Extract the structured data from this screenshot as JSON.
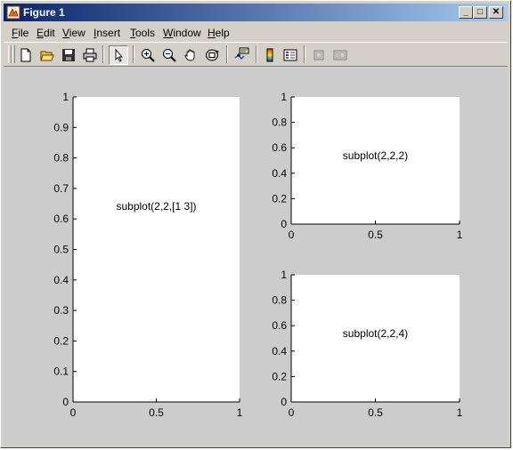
{
  "window": {
    "title": "Figure 1",
    "controls": {
      "minimize": "_",
      "maximize": "□",
      "close": "✕"
    }
  },
  "menubar": {
    "items": [
      {
        "key": "F",
        "rest": "ile"
      },
      {
        "key": "E",
        "rest": "dit"
      },
      {
        "key": "V",
        "rest": "iew"
      },
      {
        "key": "I",
        "rest": "nsert"
      },
      {
        "key": "T",
        "rest": "ools"
      },
      {
        "key": "W",
        "rest": "indow"
      },
      {
        "key": "H",
        "rest": "elp"
      }
    ]
  },
  "toolbar": {
    "icons": [
      "new-figure-icon",
      "open-file-icon",
      "save-icon",
      "print-icon",
      "edit-plot-arrow-icon",
      "zoom-in-icon",
      "zoom-out-icon",
      "pan-hand-icon",
      "rotate-3d-icon",
      "data-cursor-icon",
      "insert-colorbar-icon",
      "insert-legend-icon",
      "hide-plot-tools-icon",
      "show-plot-tools-icon"
    ]
  },
  "colors": {
    "titlebar_start": "#0a246a",
    "titlebar_end": "#a6caf0",
    "figure_bg": "#cccccc",
    "axes_bg": "#ffffff"
  },
  "chart_data": [
    {
      "type": "line",
      "annotation": "subplot(2,2,[1 3])",
      "xlim": [
        0,
        1
      ],
      "ylim": [
        0,
        1
      ],
      "xticks": [
        "0",
        "0.5",
        "1"
      ],
      "yticks": [
        "0",
        "0.1",
        "0.2",
        "0.3",
        "0.4",
        "0.5",
        "0.6",
        "0.7",
        "0.8",
        "0.9",
        "1"
      ],
      "series": []
    },
    {
      "type": "line",
      "annotation": "subplot(2,2,2)",
      "xlim": [
        0,
        1
      ],
      "ylim": [
        0,
        1
      ],
      "xticks": [
        "0",
        "0.5",
        "1"
      ],
      "yticks": [
        "0",
        "0.2",
        "0.4",
        "0.6",
        "0.8",
        "1"
      ],
      "series": []
    },
    {
      "type": "line",
      "annotation": "subplot(2,2,4)",
      "xlim": [
        0,
        1
      ],
      "ylim": [
        0,
        1
      ],
      "xticks": [
        "0",
        "0.5",
        "1"
      ],
      "yticks": [
        "0",
        "0.2",
        "0.4",
        "0.6",
        "0.8",
        "1"
      ],
      "series": []
    }
  ]
}
